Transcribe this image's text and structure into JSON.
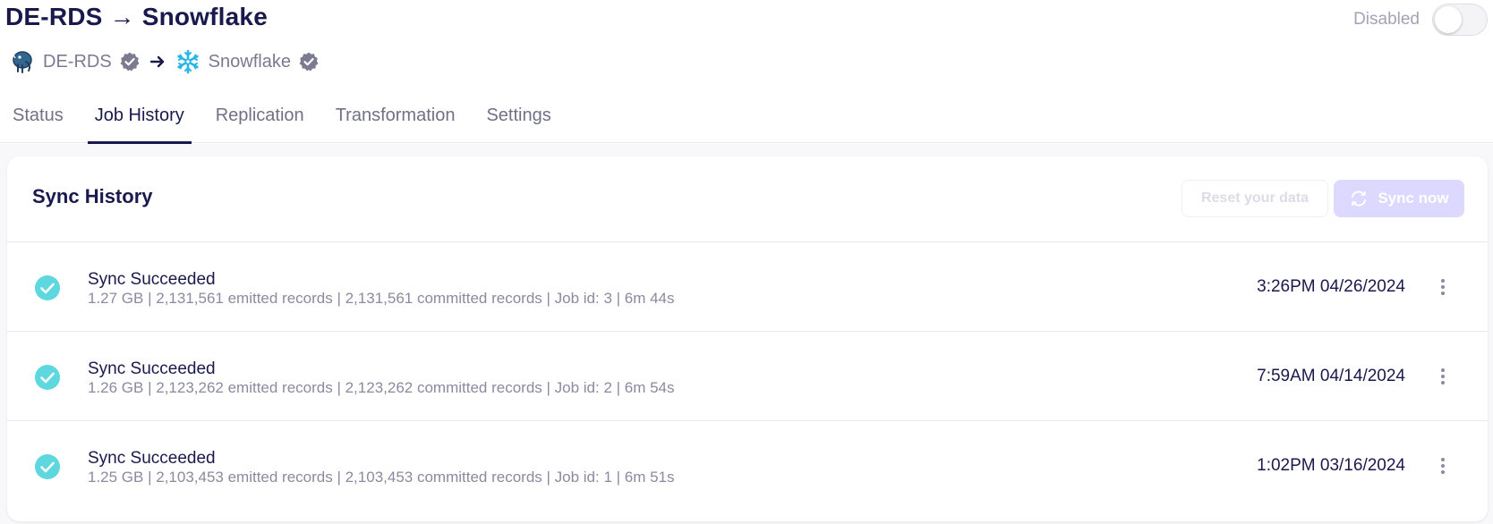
{
  "header": {
    "title": "DE-RDS → Snowflake",
    "toggle_label": "Disabled",
    "source": {
      "name": "DE-RDS",
      "icon": "postgres-elephant-icon"
    },
    "destination": {
      "name": "Snowflake",
      "icon": "snowflake-icon"
    }
  },
  "tabs": [
    {
      "label": "Status"
    },
    {
      "label": "Job History"
    },
    {
      "label": "Replication"
    },
    {
      "label": "Transformation"
    },
    {
      "label": "Settings"
    }
  ],
  "sync_history": {
    "title": "Sync History",
    "reset_label": "Reset your data",
    "sync_label": "Sync now",
    "jobs": [
      {
        "status": "Sync Succeeded",
        "meta": "1.27 GB | 2,131,561 emitted records | 2,131,561 committed records | Job id: 3 | 6m 44s",
        "time": "3:26PM 04/26/2024"
      },
      {
        "status": "Sync Succeeded",
        "meta": "1.26 GB | 2,123,262 emitted records | 2,123,262 committed records | Job id: 2 | 6m 54s",
        "time": "7:59AM 04/14/2024"
      },
      {
        "status": "Sync Succeeded",
        "meta": "1.25 GB | 2,103,453 emitted records | 2,103,453 committed records | Job id: 1 | 6m 51s",
        "time": "1:02PM 03/16/2024"
      }
    ]
  },
  "colors": {
    "text_primary": "#1a194d",
    "success": "#5ed7df",
    "sync_button_disabled": "#dcd8ff"
  }
}
